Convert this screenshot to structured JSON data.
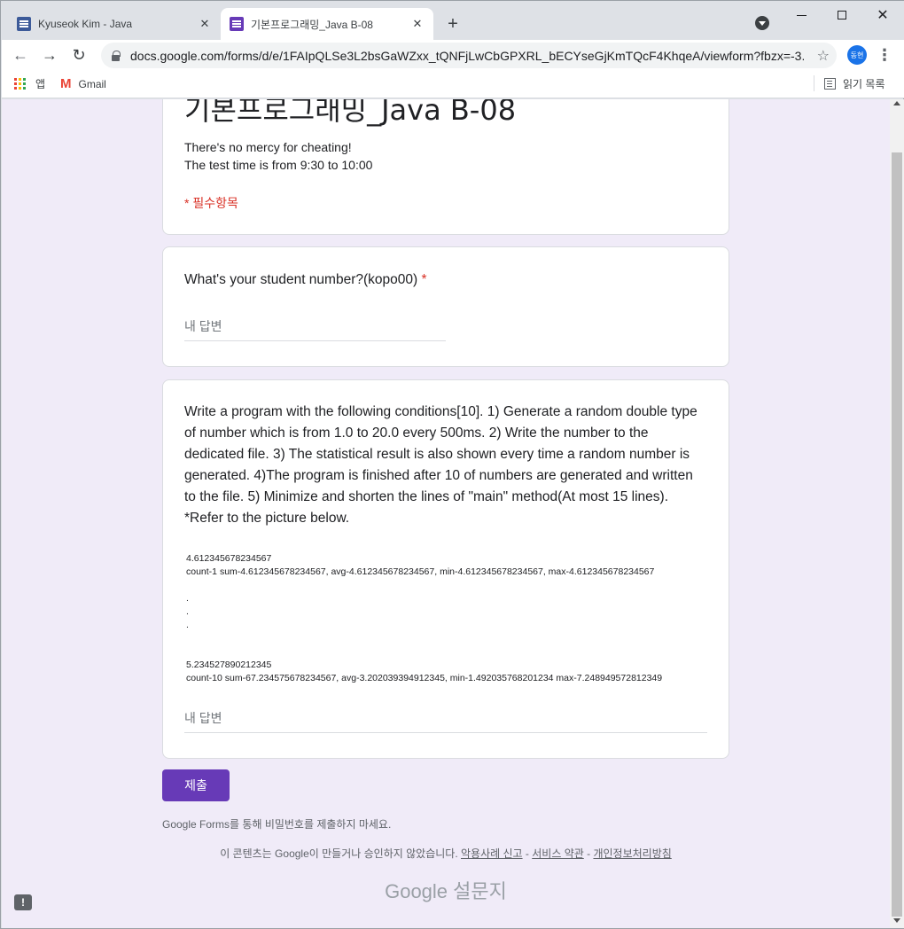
{
  "browser": {
    "tabs": [
      {
        "title": "Kyuseok Kim - Java",
        "active": false
      },
      {
        "title": "기본프로그래밍_Java B-08",
        "active": true
      }
    ],
    "url": "docs.google.com/forms/d/e/1FAIpQLSe3L2bsGaWZxx_tQNFjLwCbGPXRL_bECYseGjKmTQcF4KhqeA/viewform?fbzx=-3...",
    "profile_initials": "동현",
    "bookmarks": [
      {
        "label": "앱"
      },
      {
        "label": "Gmail"
      }
    ],
    "reading_list_label": "읽기 목록"
  },
  "form": {
    "title": "기본프로그래밍_Java B-08",
    "description_line1": "There's no mercy for cheating!",
    "description_line2": "The test time is from 9:30 to 10:00",
    "required_note": "* 필수항목",
    "question1": {
      "text": "What's your student number?(kopo00)",
      "required_marker": "*",
      "placeholder": "내 답변"
    },
    "question2": {
      "text": "Write a program with the following conditions[10]. 1) Generate a random double type of number which is from 1.0 to 20.0 every 500ms. 2) Write the number to the dedicated file. 3) The statistical result is also shown every time a random number is generated. 4)The program is finished after 10 of numbers are generated and written to the file. 5) Minimize and shorten the lines of \"main\" method(At most 15 lines). *Refer to the picture below.",
      "sample_lines": [
        "4.612345678234567",
        "count-1 sum-4.612345678234567, avg-4.612345678234567, min-4.612345678234567, max-4.612345678234567",
        "",
        ".",
        ".",
        ".",
        "",
        "",
        "5.234527890212345",
        "count-10 sum-67.234575678234567, avg-3.202039394912345, min-1.492035768201234 max-7.248949572812349"
      ],
      "placeholder": "내 답변"
    },
    "submit_label": "제출",
    "password_note": "Google Forms를 통해 비밀번호를 제출하지 마세요.",
    "footer_text": "이 콘텐츠는 Google이 만들거나 승인하지 않았습니다.",
    "footer_links": [
      "악용사례 신고",
      "서비스 약관",
      "개인정보처리방침"
    ],
    "footer_separator": " - ",
    "brand_google": "Google",
    "brand_product": "설문지"
  }
}
